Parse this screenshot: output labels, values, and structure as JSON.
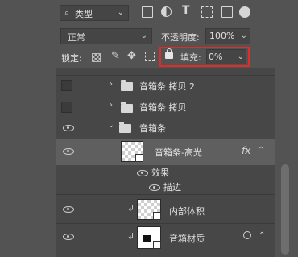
{
  "filter": {
    "search_icon": "search-icon",
    "kind": "类型"
  },
  "blend": {
    "mode": "正常",
    "opacity_label": "不透明度:",
    "opacity_value": "100%"
  },
  "lock": {
    "label": "锁定:",
    "fill_label": "填充:",
    "fill_value": "0%"
  },
  "layers": [
    {
      "name": "音箱条 拷贝 2",
      "type": "group",
      "visible": false
    },
    {
      "name": "音箱条 拷贝",
      "type": "group",
      "visible": false
    },
    {
      "name": "音箱条",
      "type": "group",
      "visible": true,
      "expanded": true
    },
    {
      "name": "音箱条-高光",
      "type": "layer",
      "selected": true,
      "fx": "fx",
      "effects_label": "效果",
      "effects": [
        "描边"
      ]
    },
    {
      "name": "内部体积",
      "type": "layer",
      "clipped": true
    },
    {
      "name": "音箱材质",
      "type": "layer",
      "clipped": true
    }
  ],
  "colors": {
    "panel": "#535353",
    "selected_row": "#474747",
    "highlight": "#e02b2b"
  }
}
